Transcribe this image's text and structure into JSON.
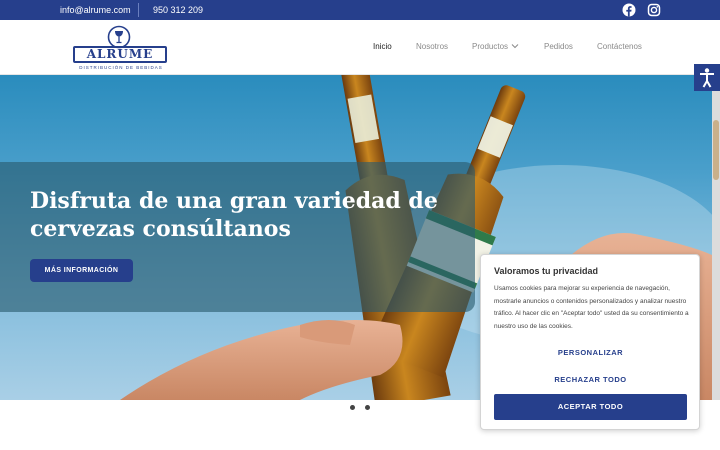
{
  "topbar": {
    "email": "info@alrume.com",
    "phone": "950 312 209",
    "social_icons": [
      "facebook-icon",
      "instagram-icon"
    ]
  },
  "logo": {
    "brand": "ALRUME",
    "tagline": "DISTRIBUCIÓN DE BEBIDAS"
  },
  "nav": {
    "items": [
      {
        "label": "Inicio",
        "active": true
      },
      {
        "label": "Nosotros",
        "active": false
      },
      {
        "label": "Productos",
        "active": false,
        "has_dropdown": true
      },
      {
        "label": "Pedidos",
        "active": false
      },
      {
        "label": "Contáctenos",
        "active": false
      }
    ]
  },
  "hero": {
    "title": "Disfruta de una gran variedad de cervezas consúltanos",
    "button": "MÁS INFORMACIÓN",
    "slides_count": 2
  },
  "cookie": {
    "title": "Valoramos tu privacidad",
    "text": "Usamos cookies para mejorar su experiencia de navegación, mostrarle anuncios o contenidos personalizados y analizar nuestro tráfico. Al hacer clic en \"Aceptar todo\" usted da su consentimiento a nuestro uso de las cookies.",
    "customize": "PERSONALIZAR",
    "reject": "RECHAZAR TODO",
    "accept": "ACEPTAR TODO"
  },
  "colors": {
    "brand": "#263f8c",
    "topbar": "#263f8c",
    "sky": "#4a9fcb"
  }
}
